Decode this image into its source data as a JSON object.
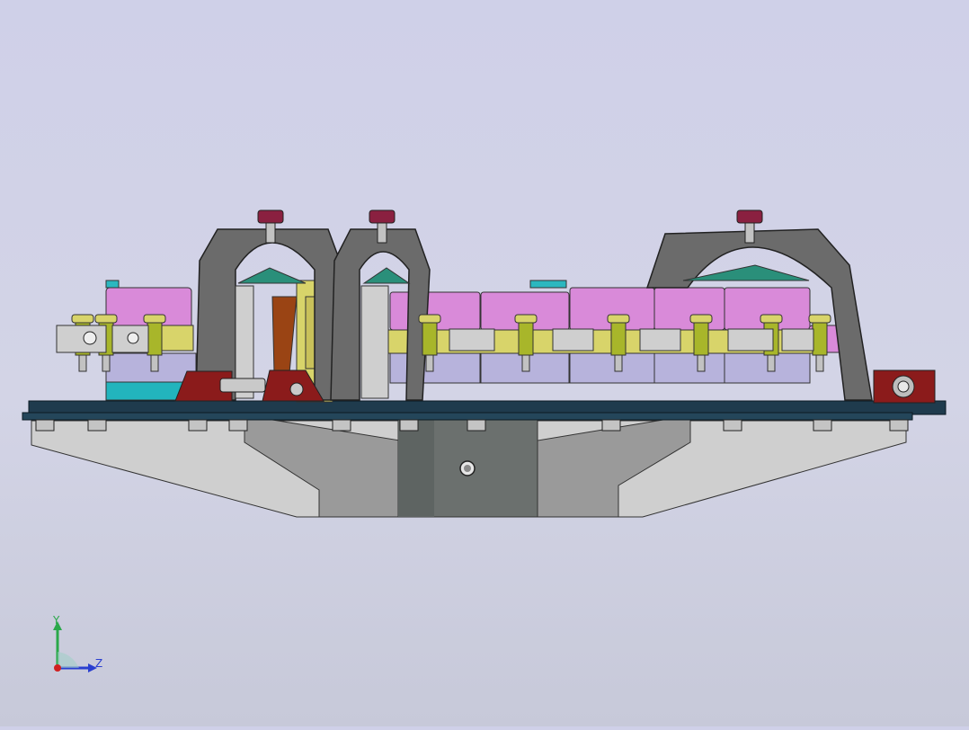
{
  "viewport": {
    "background_top": "#cfd0e8",
    "background_bottom": "#c7c9d9"
  },
  "model": {
    "colors": {
      "base_plate": "#1f3b4d",
      "base_plate_edge": "#2c5368",
      "support_gray": "#c6c6c6",
      "support_dark": "#6a6f6c",
      "clamp_frame": "#6b6b6b",
      "magenta_block": "#d98ad9",
      "lavender_block": "#b7b3dc",
      "yellow_bar": "#d8d46a",
      "green_pin": "#a8b62a",
      "cyan_plate": "#2bb7bf",
      "dark_red_block": "#8b1b1b",
      "knob": "#8a2040",
      "brown_part": "#9a4414"
    }
  },
  "triad": {
    "y_label": "Y",
    "z_label": "Z",
    "y_color": "#2aa84a",
    "z_color": "#2a3fd0",
    "x_color": "#d02020"
  }
}
